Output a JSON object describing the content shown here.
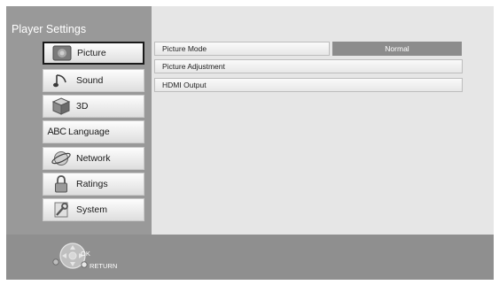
{
  "sidebar": {
    "title": "Player Settings",
    "items": [
      {
        "label": "Picture",
        "icon": "picture-icon",
        "selected": true
      },
      {
        "label": "Sound",
        "icon": "sound-icon",
        "selected": false
      },
      {
        "label": "3D",
        "icon": "3d-icon",
        "selected": false
      },
      {
        "label": "Language",
        "icon": "language-icon",
        "selected": false,
        "icon_text": "ABC"
      },
      {
        "label": "Network",
        "icon": "network-icon",
        "selected": false
      },
      {
        "label": "Ratings",
        "icon": "ratings-icon",
        "selected": false
      },
      {
        "label": "System",
        "icon": "system-icon",
        "selected": false
      }
    ]
  },
  "settings": {
    "rows": [
      {
        "label": "Picture Mode",
        "value": "Normal"
      },
      {
        "label": "Picture Adjustment"
      },
      {
        "label": "HDMI Output"
      }
    ]
  },
  "footer": {
    "ok_label": "OK",
    "return_label": "RETURN"
  },
  "colors": {
    "sidebar_bg": "#999999",
    "content_bg": "#e6e6e6",
    "footer_bg": "#8f8f8f",
    "value_bg": "#8c8c8c"
  }
}
